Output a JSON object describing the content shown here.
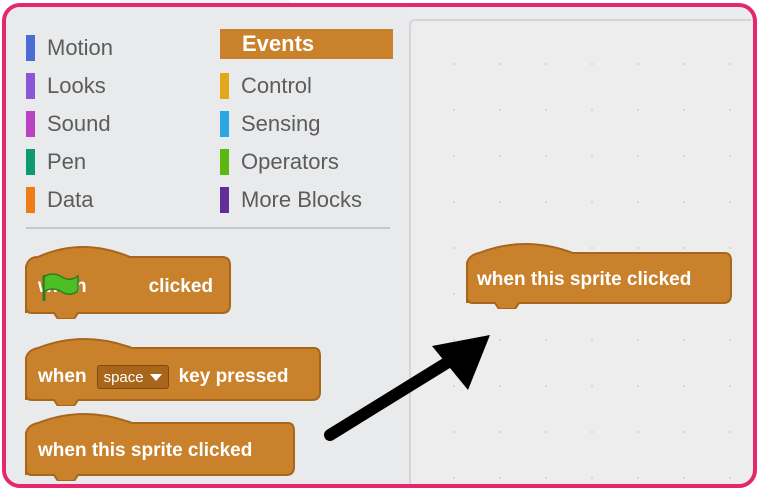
{
  "categories_left": [
    {
      "label": "Motion",
      "color": "#4a6cd4"
    },
    {
      "label": "Looks",
      "color": "#8a55d7"
    },
    {
      "label": "Sound",
      "color": "#bb42c3"
    },
    {
      "label": "Pen",
      "color": "#0e9a6c"
    },
    {
      "label": "Data",
      "color": "#ee7d16"
    }
  ],
  "categories_right": [
    {
      "label": "Events",
      "color": "#c9812c",
      "selected": true
    },
    {
      "label": "Control",
      "color": "#e1a91a"
    },
    {
      "label": "Sensing",
      "color": "#2ca5e2"
    },
    {
      "label": "Operators",
      "color": "#5cb712"
    },
    {
      "label": "More Blocks",
      "color": "#632d99"
    }
  ],
  "palette_blocks": {
    "flag_block": {
      "prefix": "when",
      "icon": "green-flag-icon",
      "suffix": "clicked"
    },
    "key_block": {
      "prefix": "when",
      "dropdown": "space",
      "suffix": "key pressed"
    },
    "sprite_block": {
      "label": "when this sprite clicked"
    }
  },
  "script_area": {
    "sprite_block": {
      "label": "when this sprite clicked"
    }
  },
  "colors": {
    "block": "#c9812c",
    "block_dark": "#a8661c",
    "frame": "#e5286d",
    "arrow": "#000000"
  }
}
